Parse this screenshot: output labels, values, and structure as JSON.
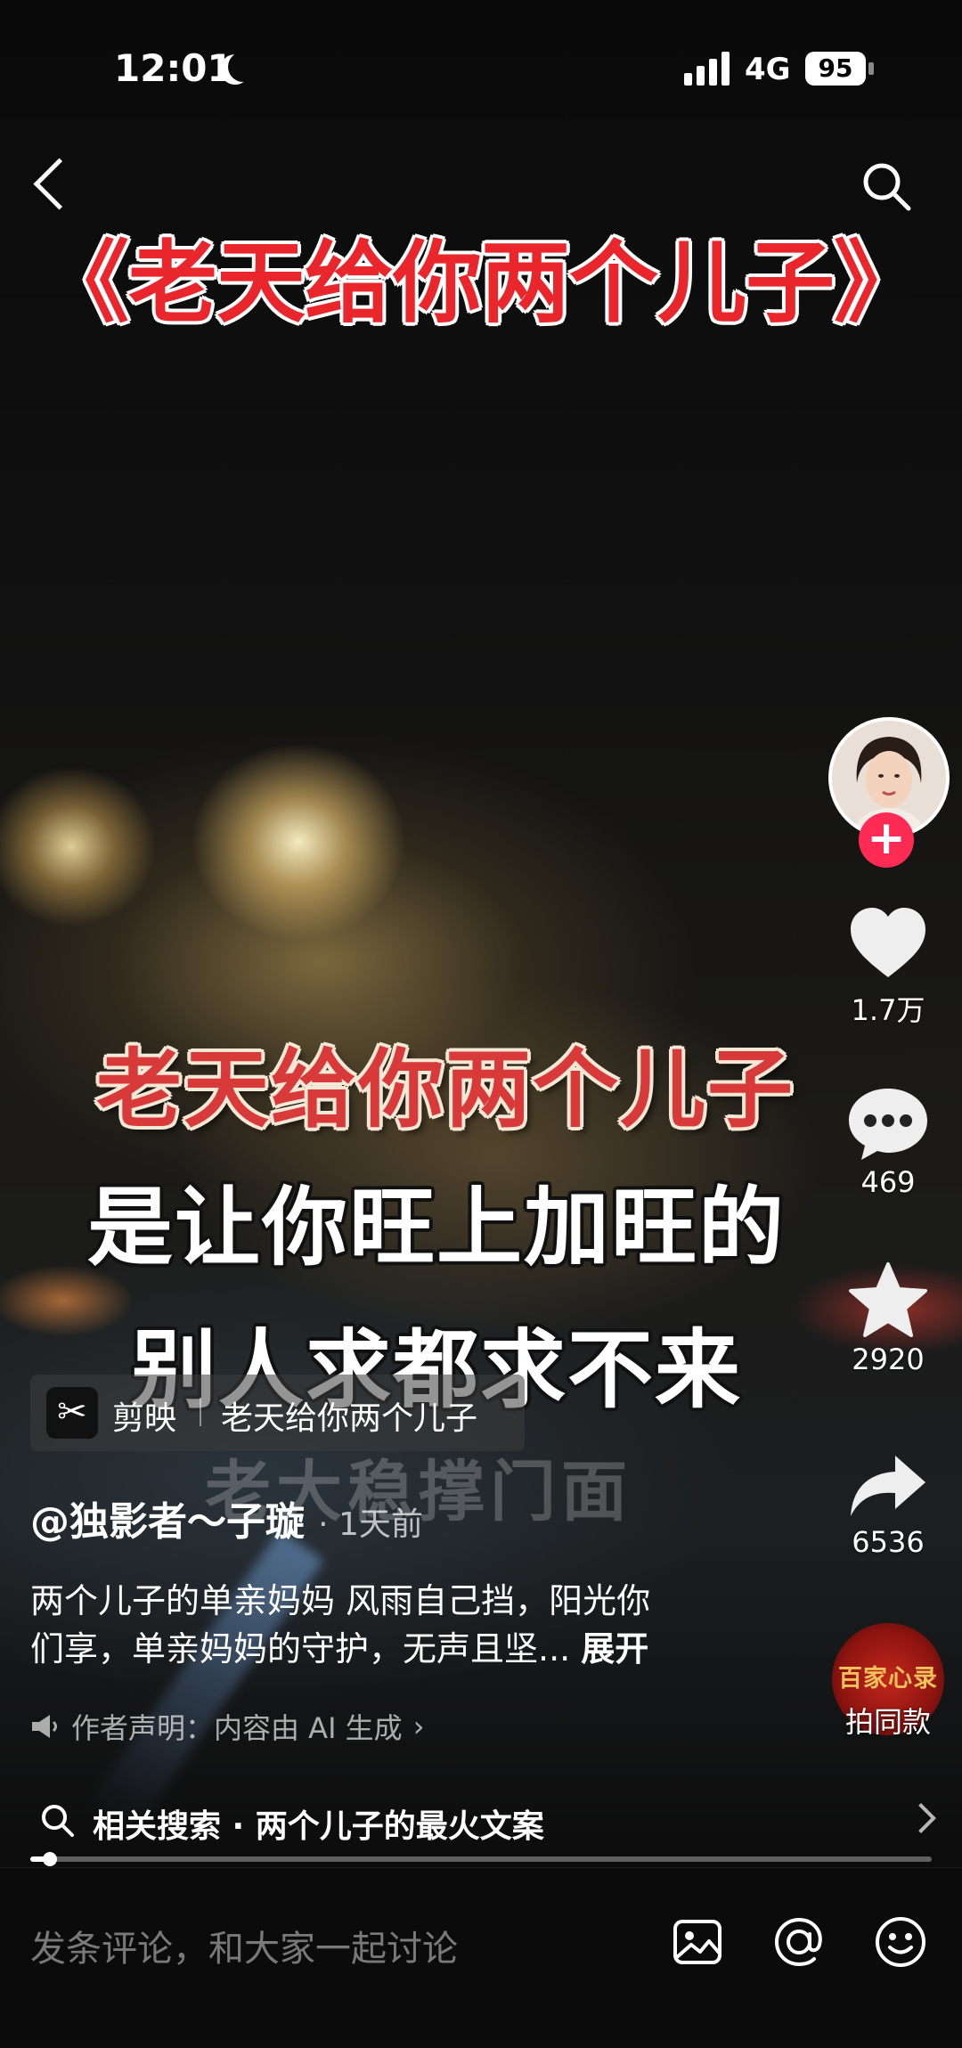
{
  "status_bar": {
    "time": "12:01",
    "network": "4G",
    "battery": "95"
  },
  "video": {
    "title": "《老天给你两个儿子》",
    "subtitle_lines": [
      "老天给你两个儿子",
      "是让你旺上加旺的",
      "别人求都求不来"
    ],
    "background_caption": "老大稳撑门面"
  },
  "capcut": {
    "logo": "✂",
    "app_name": "剪映",
    "template_title": "老天给你两个儿子"
  },
  "author": {
    "name": "@独影者～子璇",
    "time": "· 1天前"
  },
  "description": {
    "line1": "两个儿子的单亲妈妈 风雨自己挡，阳光你",
    "line2": "们享，单亲妈妈的守护，无声且坚...",
    "expand": "展开"
  },
  "ai_statement": "作者声明：内容由 AI 生成",
  "ai_chevron": "›",
  "actions": {
    "likes": "1.7万",
    "comments": "469",
    "favorites": "2920",
    "shares": "6536",
    "follow": "+",
    "music_disc_text": "百家心录",
    "same_style": "拍同款"
  },
  "related_search": "相关搜索 · 两个儿子的最火文案",
  "progress": 0.022,
  "comment_bar": {
    "placeholder": "发条评论，和大家一起讨论"
  },
  "icons": [
    "back-icon",
    "search-icon",
    "heart-icon",
    "comment-icon",
    "star-icon",
    "share-icon",
    "image-icon",
    "at-icon",
    "emoji-icon",
    "speaker-icon"
  ]
}
